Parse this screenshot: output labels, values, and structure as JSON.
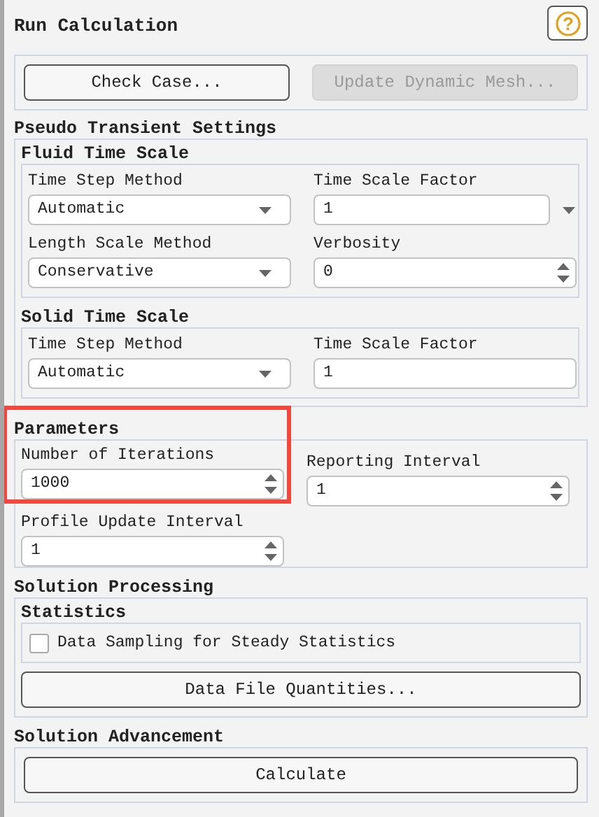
{
  "title": "Run Calculation",
  "help_button": "?",
  "top_buttons": [
    {
      "label": "Check Case...",
      "disabled": false
    },
    {
      "label": "Update Dynamic Mesh...",
      "disabled": true
    }
  ],
  "pseudo_transient": {
    "heading": "Pseudo Transient Settings",
    "groups": [
      {
        "heading": "Fluid Time Scale",
        "fields": [
          {
            "label": "Time Step Method",
            "kind": "dropdown",
            "value": "Automatic"
          },
          {
            "label": "Time Scale Factor",
            "kind": "combo",
            "value": "1"
          },
          {
            "label": "Length Scale Method",
            "kind": "dropdown",
            "value": "Conservative"
          },
          {
            "label": "Verbosity",
            "kind": "spinner",
            "value": "0"
          }
        ]
      },
      {
        "heading": "Solid Time Scale",
        "fields": [
          {
            "label": "Time Step Method",
            "kind": "dropdown",
            "value": "Automatic"
          },
          {
            "label": "Time Scale Factor",
            "kind": "text",
            "value": "1"
          }
        ]
      }
    ]
  },
  "parameters": {
    "heading": "Parameters",
    "highlighted": true,
    "fields": [
      {
        "label": "Number of Iterations",
        "kind": "spinner",
        "value": "1000"
      },
      {
        "label": "Reporting Interval",
        "kind": "spinner",
        "value": "1"
      },
      {
        "label": "Profile Update Interval",
        "kind": "spinner",
        "value": "1"
      }
    ]
  },
  "solution_processing": {
    "heading": "Solution Processing",
    "statistics": {
      "heading": "Statistics",
      "checkbox": {
        "label": "Data Sampling for Steady Statistics",
        "checked": false
      }
    },
    "button": "Data File Quantities..."
  },
  "solution_advancement": {
    "heading": "Solution Advancement",
    "button": "Calculate"
  }
}
